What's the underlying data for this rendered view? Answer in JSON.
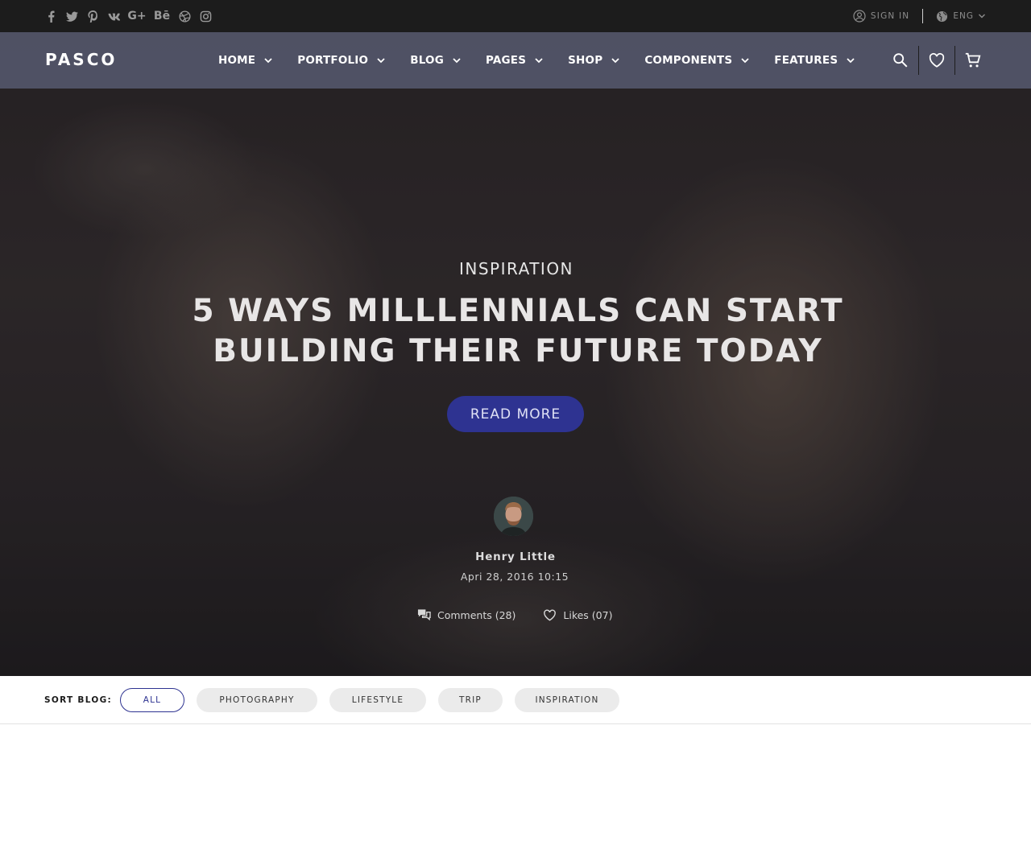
{
  "topbar": {
    "socials": [
      {
        "icon": "facebook-icon",
        "glyph": "f"
      },
      {
        "icon": "twitter-icon",
        "glyph": "t"
      },
      {
        "icon": "pinterest-icon",
        "glyph": "p"
      },
      {
        "icon": "vk-icon",
        "glyph": "vk"
      },
      {
        "icon": "google-plus-icon",
        "glyph": "G+"
      },
      {
        "icon": "behance-icon",
        "glyph": "Bē"
      },
      {
        "icon": "dribbble-icon",
        "glyph": "d"
      },
      {
        "icon": "instagram-icon",
        "glyph": "ig"
      }
    ],
    "sign_in": "SIGN IN",
    "language": "ENG"
  },
  "nav": {
    "logo": "PASCO",
    "items": [
      "HOME",
      "PORTFOLIO",
      "BLOG",
      "PAGES",
      "SHOP",
      "COMPONENTS",
      "FEATURES"
    ],
    "icons": [
      "search-icon",
      "heart-icon",
      "cart-icon"
    ]
  },
  "hero": {
    "category": "INSPIRATION",
    "title_line1": "5 WAYS MILLLENNIALS CAN START",
    "title_line2": "BUILDING THEIR FUTURE TODAY",
    "read_more": "READ MORE",
    "author": "Henry Little",
    "date": "Apri 28, 2016 10:15",
    "comments": "Comments (28)",
    "likes": "Likes (07)"
  },
  "sort": {
    "label": "SORT BLOG:",
    "options": [
      "ALL",
      "PHOTOGRAPHY",
      "LIFESTYLE",
      "TRIP",
      "INSPIRATION"
    ],
    "selected": "ALL"
  },
  "colors": {
    "accent": "#2e3391",
    "topbar_bg": "#1c1c1c",
    "pill_bg": "#ebebeb"
  }
}
